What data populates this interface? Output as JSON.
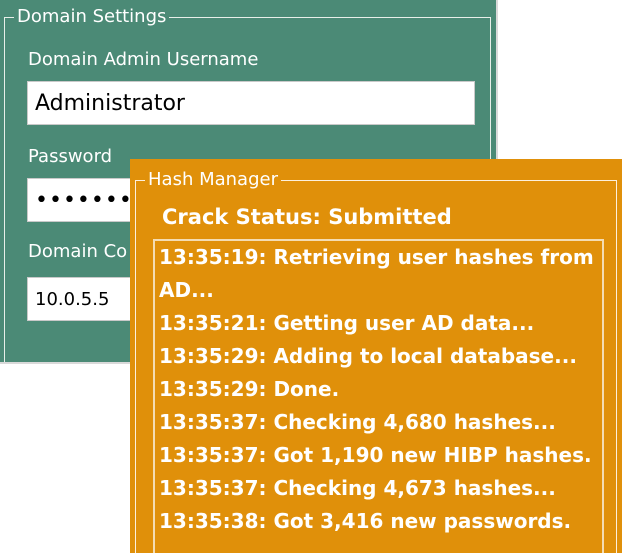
{
  "domain_settings": {
    "title": "Domain Settings",
    "username_label": "Domain Admin Username",
    "username_value": "Administrator",
    "password_label": "Password",
    "password_value": "••••••••",
    "controller_label": "Domain Co",
    "controller_value": "10.0.5.5"
  },
  "hash_manager": {
    "title": "Hash Manager",
    "crack_status": "Crack Status: Submitted",
    "log_lines": [
      "13:35:19: Retrieving user hashes from",
      "AD...",
      "13:35:21: Getting user AD data...",
      "13:35:29: Adding to local database...",
      "13:35:29: Done.",
      "13:35:37: Checking 4,680 hashes...",
      "13:35:37: Got 1,190 new HIBP hashes.",
      "13:35:37: Checking 4,673 hashes...",
      "13:35:38: Got 3,416 new passwords."
    ]
  },
  "colors": {
    "domain_panel_bg": "#4b8a76",
    "hash_panel_bg": "#e0900a",
    "text": "#ffffff"
  }
}
